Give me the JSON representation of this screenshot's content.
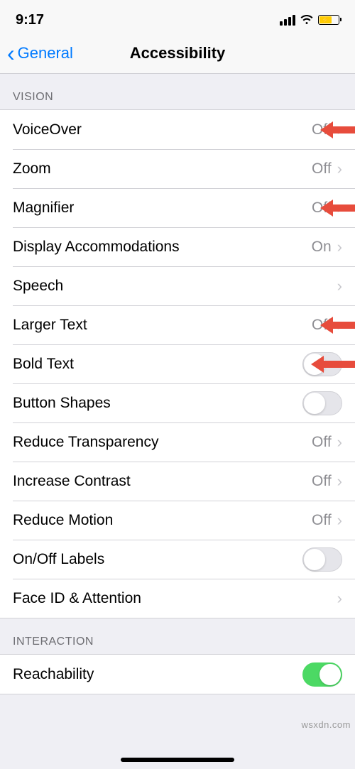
{
  "status": {
    "time": "9:17"
  },
  "nav": {
    "back": "General",
    "title": "Accessibility"
  },
  "sections": {
    "vision": {
      "header": "VISION",
      "items": [
        {
          "label": "VoiceOver",
          "value": "Off",
          "type": "disclosure",
          "arrow": true
        },
        {
          "label": "Zoom",
          "value": "Off",
          "type": "disclosure"
        },
        {
          "label": "Magnifier",
          "value": "Off",
          "type": "disclosure",
          "arrow": true
        },
        {
          "label": "Display Accommodations",
          "value": "On",
          "type": "disclosure"
        },
        {
          "label": "Speech",
          "value": "",
          "type": "disclosure"
        },
        {
          "label": "Larger Text",
          "value": "Off",
          "type": "disclosure",
          "arrow": true
        },
        {
          "label": "Bold Text",
          "type": "switch",
          "on": false,
          "arrow": true
        },
        {
          "label": "Button Shapes",
          "type": "switch",
          "on": false
        },
        {
          "label": "Reduce Transparency",
          "value": "Off",
          "type": "disclosure"
        },
        {
          "label": "Increase Contrast",
          "value": "Off",
          "type": "disclosure"
        },
        {
          "label": "Reduce Motion",
          "value": "Off",
          "type": "disclosure"
        },
        {
          "label": "On/Off Labels",
          "type": "switch",
          "on": false
        },
        {
          "label": "Face ID & Attention",
          "value": "",
          "type": "disclosure"
        }
      ]
    },
    "interaction": {
      "header": "INTERACTION",
      "items": [
        {
          "label": "Reachability",
          "type": "switch",
          "on": true
        }
      ]
    }
  },
  "watermark": "wsxdn.com",
  "arrow_color": "#e74c3c"
}
